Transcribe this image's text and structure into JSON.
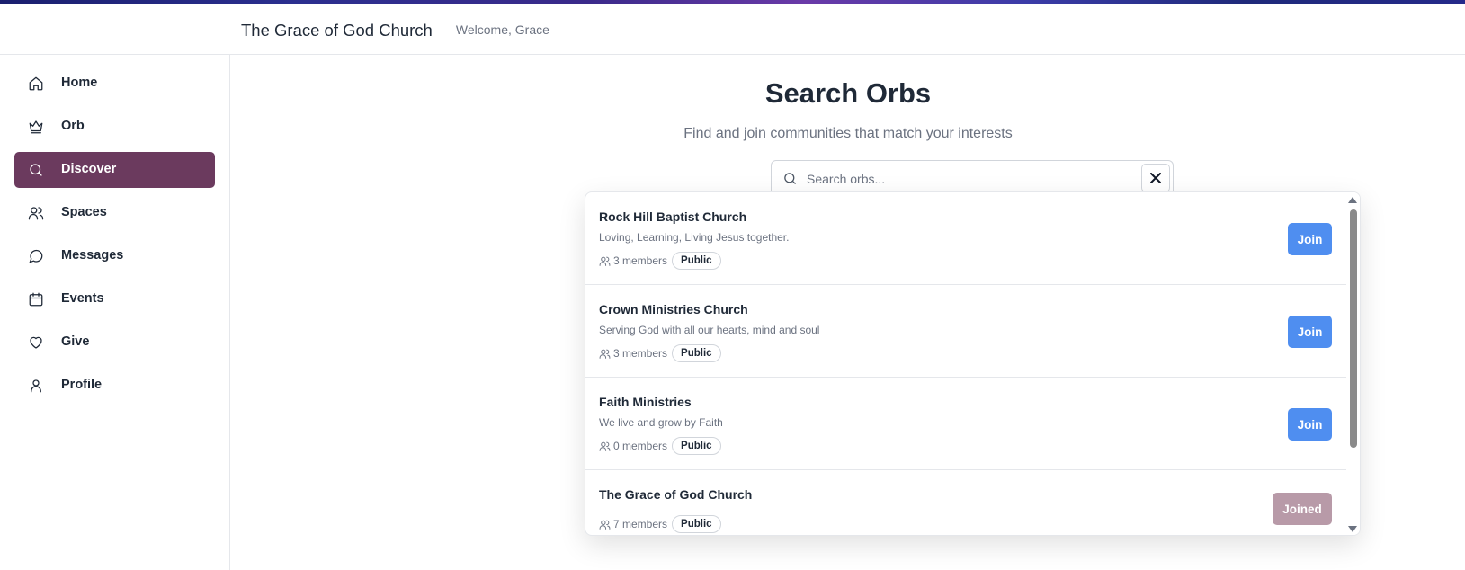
{
  "header": {
    "title": "The Grace of God Church",
    "welcome": "— Welcome, Grace"
  },
  "sidebar": {
    "items": [
      {
        "label": "Home",
        "icon": "home-icon",
        "active": false
      },
      {
        "label": "Orb",
        "icon": "crown-icon",
        "active": false
      },
      {
        "label": "Discover",
        "icon": "search-icon",
        "active": true
      },
      {
        "label": "Spaces",
        "icon": "users-icon",
        "active": false
      },
      {
        "label": "Messages",
        "icon": "message-icon",
        "active": false
      },
      {
        "label": "Events",
        "icon": "calendar-icon",
        "active": false
      },
      {
        "label": "Give",
        "icon": "heart-icon",
        "active": false
      },
      {
        "label": "Profile",
        "icon": "user-icon",
        "active": false
      }
    ]
  },
  "main": {
    "title": "Search Orbs",
    "subtitle": "Find and join communities that match your interests"
  },
  "search": {
    "placeholder": "Search orbs...",
    "value": ""
  },
  "results": [
    {
      "name": "Rock Hill Baptist Church",
      "description": "Loving, Learning, Living Jesus together.",
      "members": "3 members",
      "visibility": "Public",
      "action": "Join"
    },
    {
      "name": "Crown Ministries Church",
      "description": "Serving God with all our hearts, mind and soul",
      "members": "3 members",
      "visibility": "Public",
      "action": "Join"
    },
    {
      "name": "Faith Ministries",
      "description": "We live and grow by Faith",
      "members": "0 members",
      "visibility": "Public",
      "action": "Join"
    },
    {
      "name": "The Grace of God Church",
      "description": "",
      "members": "7 members",
      "visibility": "Public",
      "action": "Joined"
    }
  ],
  "colors": {
    "active_nav": "#6b3a5e",
    "join_button": "#4f8ef0",
    "joined_button": "#b89aa8"
  }
}
